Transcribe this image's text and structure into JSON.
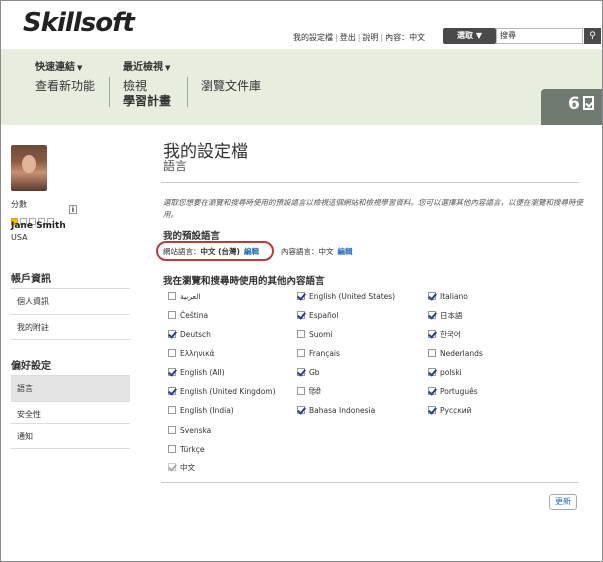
{
  "header": {
    "logo_text": "Skillsoft",
    "links": [
      "我的設定檔",
      "登出",
      "說明",
      "內容：中文"
    ],
    "select_label": "選取 ▼",
    "search_placeholder": "搜尋"
  },
  "nav": {
    "menus": [
      "快速連結",
      "最近檢視"
    ],
    "links": [
      "查看新功能",
      "檢視",
      "學習計畫",
      "瀏覽文件庫"
    ],
    "counter": "6"
  },
  "sidebar": {
    "score_label": "分數",
    "score_filled": 1,
    "score_total": 5,
    "user_name": "Jane Smith",
    "user_country": "USA",
    "section1_heading": "帳戶資訊",
    "section1_items": [
      "個人資訊",
      "我的附註"
    ],
    "section2_heading": "偏好設定",
    "section2_items": [
      "語言",
      "安全性",
      "通知"
    ],
    "active_item": "語言"
  },
  "main": {
    "title": "我的設定檔",
    "subtitle": "語言",
    "intro": "選取您想要在瀏覽和搜尋時使用的預設語言以檢視這個網站和檢視學習資料。您可以選擇其他內容語言，以便在瀏覽和搜尋時使用。",
    "default_lang_heading": "我的預設語言",
    "site_lang_label": "網站語言：",
    "site_lang_value": "中文 (台灣)",
    "content_lang_label": "內容語言：",
    "content_lang_value": "中文",
    "edit_label": "編輯",
    "other_lang_heading": "我在瀏覽和搜尋時使用的其他內容語言",
    "update_label": "更新",
    "languages": {
      "col1": [
        {
          "name": "العربية",
          "checked": false
        },
        {
          "name": "Čeština",
          "checked": false
        },
        {
          "name": "Deutsch",
          "checked": true
        },
        {
          "name": "Ελληνικά",
          "checked": false
        },
        {
          "name": "English (All)",
          "checked": true
        },
        {
          "name": "English (United Kingdom)",
          "checked": true
        },
        {
          "name": "English (India)",
          "checked": false
        },
        {
          "name": "Svenska",
          "checked": false
        },
        {
          "name": "Türkçe",
          "checked": false
        },
        {
          "name": "中文",
          "checked": true,
          "disabled": true
        }
      ],
      "col2": [
        {
          "name": "English (United States)",
          "checked": true
        },
        {
          "name": "Español",
          "checked": true
        },
        {
          "name": "Suomi",
          "checked": false
        },
        {
          "name": "Français",
          "checked": false
        },
        {
          "name": "Gb",
          "checked": true
        },
        {
          "name": "हिंदी",
          "checked": false
        },
        {
          "name": "Bahasa Indonesia",
          "checked": true
        }
      ],
      "col3": [
        {
          "name": "Italiano",
          "checked": true
        },
        {
          "name": "日本語",
          "checked": true
        },
        {
          "name": "한국어",
          "checked": true
        },
        {
          "name": "Nederlands",
          "checked": false
        },
        {
          "name": "polski",
          "checked": true
        },
        {
          "name": "Português",
          "checked": true
        },
        {
          "name": "Русский",
          "checked": true
        }
      ]
    }
  }
}
